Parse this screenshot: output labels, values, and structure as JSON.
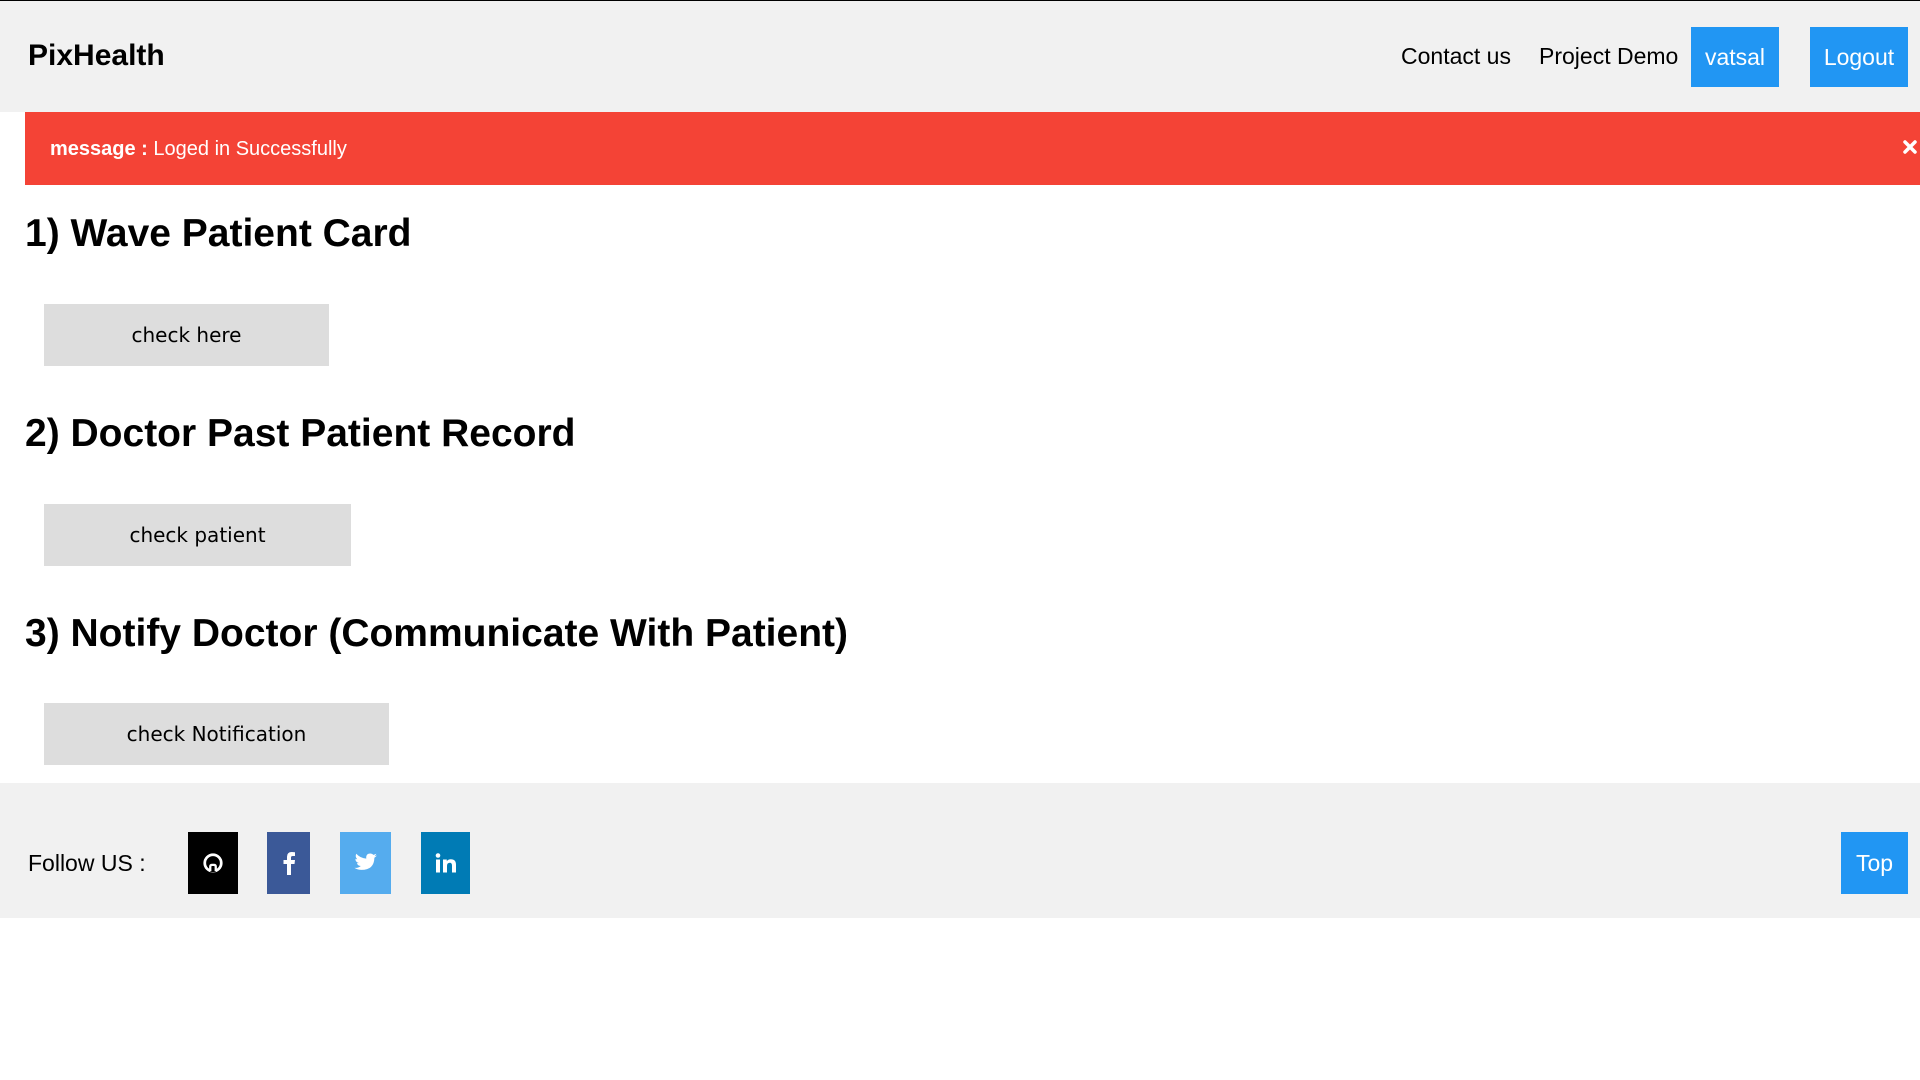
{
  "header": {
    "brand": "PixHealth",
    "nav": {
      "contact": "Contact us",
      "demo": "Project Demo",
      "user": "vatsal",
      "logout": "Logout"
    }
  },
  "alert": {
    "label": "message :",
    "text": "Loged in Successfully",
    "close_icon": "close-icon",
    "color": "#f44336"
  },
  "sections": [
    {
      "title": "1) Wave Patient Card",
      "button": "check here"
    },
    {
      "title": "2) Doctor Past Patient Record",
      "button": "check patient"
    },
    {
      "title": "3) Notify Doctor (Communicate With Patient)",
      "button": "check Notification"
    }
  ],
  "footer": {
    "follow_label": "Follow US :",
    "social": [
      {
        "icon": "github-icon",
        "color": "#000000"
      },
      {
        "icon": "facebook-icon",
        "color": "#3b5998"
      },
      {
        "icon": "twitter-icon",
        "color": "#55acee"
      },
      {
        "icon": "linkedin-icon",
        "color": "#007bb5"
      }
    ],
    "top_button": "Top"
  },
  "colors": {
    "accent": "#2196f3",
    "bar_background": "#f1f1f1",
    "button_gray": "#dddddd"
  }
}
